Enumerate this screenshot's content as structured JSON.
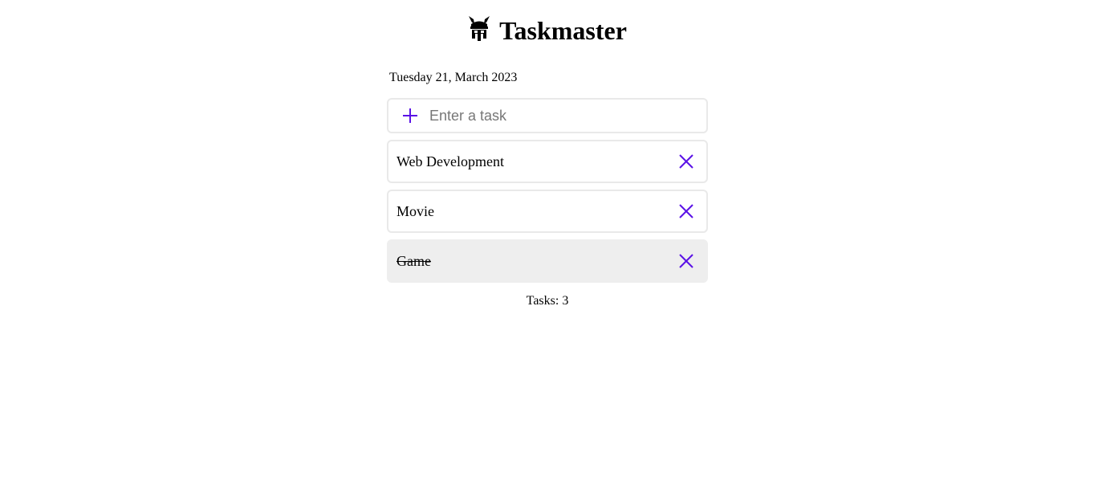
{
  "app": {
    "title": "Taskmaster",
    "logo_icon": "viking-helmet-icon"
  },
  "date": "Tuesday 21, March 2023",
  "input": {
    "placeholder": "Enter a task",
    "value": "",
    "add_icon": "plus-icon"
  },
  "tasks": [
    {
      "label": "Web Development",
      "done": false,
      "delete_icon": "close-icon"
    },
    {
      "label": "Movie",
      "done": false,
      "delete_icon": "close-icon"
    },
    {
      "label": "Game",
      "done": true,
      "delete_icon": "close-icon"
    }
  ],
  "footer": {
    "count_label": "Tasks: 3"
  },
  "colors": {
    "accent": "#5b12e6",
    "border": "#e9e9e9",
    "done_bg": "#eeeeee"
  }
}
